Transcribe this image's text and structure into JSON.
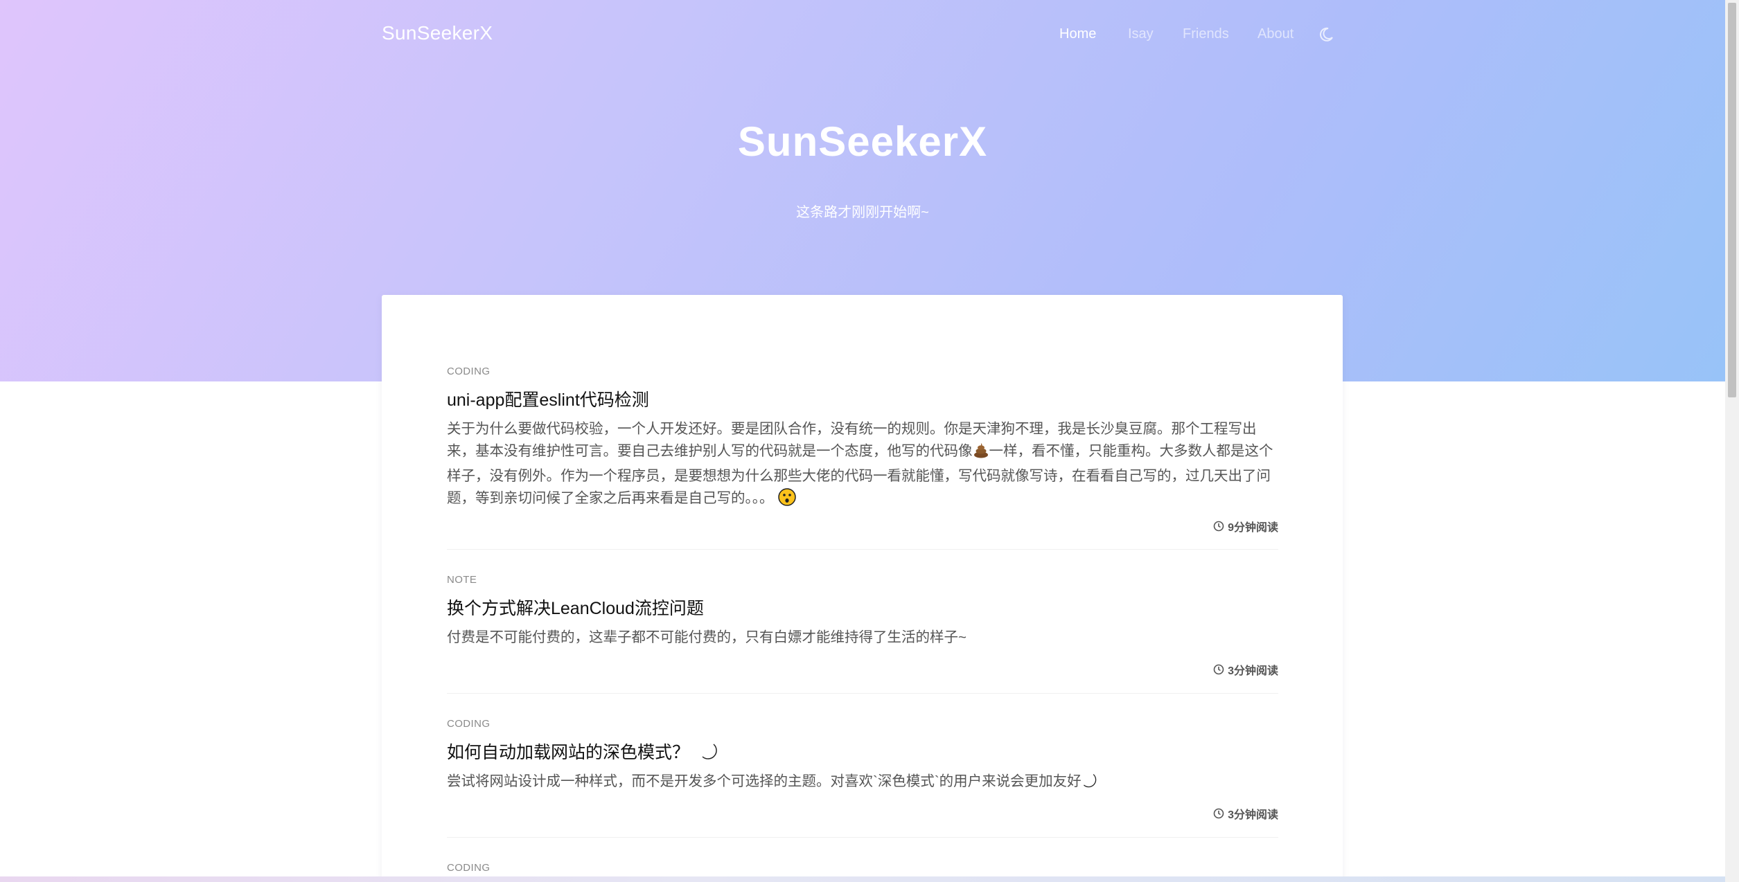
{
  "brand": "SunSeekerX",
  "nav": {
    "items": [
      {
        "label": "Home",
        "active": true
      },
      {
        "label": "Isay",
        "active": false
      },
      {
        "label": "Friends",
        "active": false
      },
      {
        "label": "About",
        "active": false
      }
    ],
    "theme_toggle_icon": "moon-icon"
  },
  "hero": {
    "title": "SunSeekerX",
    "subtitle": "这条路才刚刚开始啊~"
  },
  "posts": [
    {
      "category": "CODING",
      "title": "uni-app配置eslint代码检测",
      "excerpt_part1": "关于为什么要做代码校验，一个人开发还好。要是团队合作，没有统一的规则。你是天津狗不理，我是长沙臭豆腐。那个工程写出来，基本没有维护性可言。要自己去维护别人写的代码就是一个态度，他写的代码像",
      "excerpt_part2": "一样，看不懂，只能重构。大多数人都是这个样子，没有例外。作为一个程序员，是要想想为什么那些大佬的代码一看就能懂，写代码就像写诗，在看看自己写的，过几天出了问题，等到亲切问候了全家之后再来看是自己写的。。。",
      "inline_emoji_1": "poop-icon",
      "inline_emoji_2": "astonished-face-icon",
      "read_time": "9分钟阅读"
    },
    {
      "category": "NOTE",
      "title": "换个方式解决LeanCloud流控问题",
      "excerpt": "付费是不可能付费的，这辈子都不可能付费的，只有白嫖才能维持得了生活的样子~",
      "read_time": "3分钟阅读"
    },
    {
      "category": "CODING",
      "title": "如何自动加载网站的深色模式？",
      "title_emoji": "crescent-moon-icon",
      "excerpt": "尝试将网站设计成一种样式，而不是开发多个可选择的主题。对喜欢`深色模式`的用户来说会更加友好",
      "excerpt_emoji": "crescent-moon-icon",
      "read_time": "3分钟阅读"
    },
    {
      "category": "CODING"
    }
  ]
}
